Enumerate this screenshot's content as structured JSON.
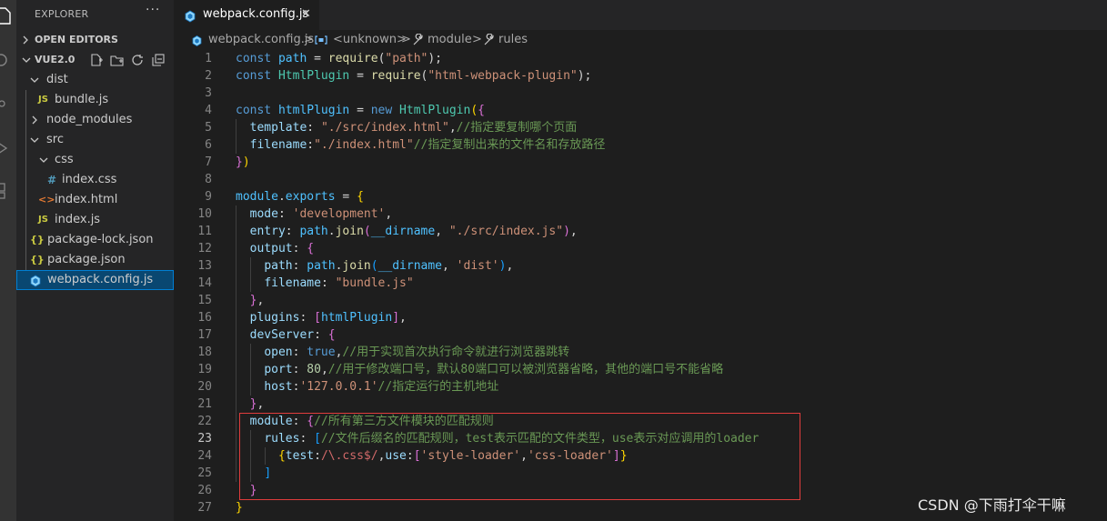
{
  "explorer": {
    "title": "EXPLORER",
    "more": "···",
    "open_editors": "OPEN EDITORS",
    "workspace": "VUE2.0",
    "tree": [
      {
        "label": "dist",
        "kind": "folder-open"
      },
      {
        "label": "bundle.js",
        "kind": "js",
        "icon_text": "JS"
      },
      {
        "label": "node_modules",
        "kind": "folder-closed"
      },
      {
        "label": "src",
        "kind": "folder-open"
      },
      {
        "label": "css",
        "kind": "folder-open"
      },
      {
        "label": "index.css",
        "kind": "css",
        "icon_text": "#"
      },
      {
        "label": "index.html",
        "kind": "html",
        "icon_text": "<>"
      },
      {
        "label": "index.js",
        "kind": "js",
        "icon_text": "JS"
      },
      {
        "label": "package-lock.json",
        "kind": "json",
        "icon_text": "{}"
      },
      {
        "label": "package.json",
        "kind": "json",
        "icon_text": "{}"
      },
      {
        "label": "webpack.config.js",
        "kind": "webpack",
        "selected": true
      }
    ]
  },
  "tab": {
    "label": "webpack.config.js",
    "close": "✕"
  },
  "breadcrumb": {
    "items": [
      "webpack.config.js",
      "<unknown>",
      "module",
      "rules"
    ],
    "separator": ">"
  },
  "editor": {
    "active_line": 23,
    "lines": [
      {
        "n": "1",
        "tokens": [
          [
            "kw",
            "const "
          ],
          [
            "var",
            "path"
          ],
          [
            "pn",
            " = "
          ],
          [
            "fn",
            "require"
          ],
          [
            "pn",
            "("
          ],
          [
            "str",
            "\"path\""
          ],
          [
            "pn",
            ");"
          ]
        ]
      },
      {
        "n": "2",
        "tokens": [
          [
            "kw",
            "const "
          ],
          [
            "cls",
            "HtmlPlugin"
          ],
          [
            "pn",
            " = "
          ],
          [
            "fn",
            "require"
          ],
          [
            "pn",
            "("
          ],
          [
            "str",
            "\"html-webpack-plugin\""
          ],
          [
            "pn",
            ");"
          ]
        ]
      },
      {
        "n": "3",
        "tokens": []
      },
      {
        "n": "4",
        "tokens": [
          [
            "kw",
            "const "
          ],
          [
            "var",
            "htmlPlugin"
          ],
          [
            "pn",
            " = "
          ],
          [
            "kw",
            "new "
          ],
          [
            "cls",
            "HtmlPlugin"
          ],
          [
            "br1",
            "("
          ],
          [
            "br2",
            "{"
          ]
        ]
      },
      {
        "n": "5",
        "tokens": [
          [
            "pn",
            "  "
          ],
          [
            "prop",
            "template"
          ],
          [
            "pn",
            ": "
          ],
          [
            "str",
            "\"./src/index.html\""
          ],
          [
            "pn",
            ","
          ],
          [
            "cm",
            "//指定要复制哪个页面"
          ]
        ]
      },
      {
        "n": "6",
        "tokens": [
          [
            "pn",
            "  "
          ],
          [
            "prop",
            "filename"
          ],
          [
            "pn",
            ":"
          ],
          [
            "str",
            "\"./index.html\""
          ],
          [
            "cm",
            "//指定复制出来的文件名和存放路径"
          ]
        ]
      },
      {
        "n": "7",
        "tokens": [
          [
            "br2",
            "}"
          ],
          [
            "br1",
            ")"
          ]
        ]
      },
      {
        "n": "8",
        "tokens": []
      },
      {
        "n": "9",
        "tokens": [
          [
            "var",
            "module"
          ],
          [
            "pn",
            "."
          ],
          [
            "var",
            "exports"
          ],
          [
            "pn",
            " = "
          ],
          [
            "br1",
            "{"
          ]
        ]
      },
      {
        "n": "10",
        "tokens": [
          [
            "pn",
            "  "
          ],
          [
            "prop",
            "mode"
          ],
          [
            "pn",
            ": "
          ],
          [
            "str",
            "'development'"
          ],
          [
            "pn",
            ","
          ]
        ]
      },
      {
        "n": "11",
        "tokens": [
          [
            "pn",
            "  "
          ],
          [
            "prop",
            "entry"
          ],
          [
            "pn",
            ": "
          ],
          [
            "var",
            "path"
          ],
          [
            "pn",
            "."
          ],
          [
            "fn",
            "join"
          ],
          [
            "br2",
            "("
          ],
          [
            "var",
            "__dirname"
          ],
          [
            "pn",
            ", "
          ],
          [
            "str",
            "\"./src/index.js\""
          ],
          [
            "br2",
            ")"
          ],
          [
            "pn",
            ","
          ]
        ]
      },
      {
        "n": "12",
        "tokens": [
          [
            "pn",
            "  "
          ],
          [
            "prop",
            "output"
          ],
          [
            "pn",
            ": "
          ],
          [
            "br2",
            "{"
          ]
        ]
      },
      {
        "n": "13",
        "tokens": [
          [
            "pn",
            "    "
          ],
          [
            "prop",
            "path"
          ],
          [
            "pn",
            ": "
          ],
          [
            "var",
            "path"
          ],
          [
            "pn",
            "."
          ],
          [
            "fn",
            "join"
          ],
          [
            "br3",
            "("
          ],
          [
            "var",
            "__dirname"
          ],
          [
            "pn",
            ", "
          ],
          [
            "str",
            "'dist'"
          ],
          [
            "br3",
            ")"
          ],
          [
            "pn",
            ","
          ]
        ]
      },
      {
        "n": "14",
        "tokens": [
          [
            "pn",
            "    "
          ],
          [
            "prop",
            "filename"
          ],
          [
            "pn",
            ": "
          ],
          [
            "str",
            "\"bundle.js\""
          ]
        ]
      },
      {
        "n": "15",
        "tokens": [
          [
            "pn",
            "  "
          ],
          [
            "br2",
            "}"
          ],
          [
            "pn",
            ","
          ]
        ]
      },
      {
        "n": "16",
        "tokens": [
          [
            "pn",
            "  "
          ],
          [
            "prop",
            "plugins"
          ],
          [
            "pn",
            ": "
          ],
          [
            "br2",
            "["
          ],
          [
            "var",
            "htmlPlugin"
          ],
          [
            "br2",
            "]"
          ],
          [
            "pn",
            ","
          ]
        ]
      },
      {
        "n": "17",
        "tokens": [
          [
            "pn",
            "  "
          ],
          [
            "prop",
            "devServer"
          ],
          [
            "pn",
            ": "
          ],
          [
            "br2",
            "{"
          ]
        ]
      },
      {
        "n": "18",
        "tokens": [
          [
            "pn",
            "    "
          ],
          [
            "prop",
            "open"
          ],
          [
            "pn",
            ": "
          ],
          [
            "kw",
            "true"
          ],
          [
            "pn",
            ","
          ],
          [
            "cm",
            "//用于实现首次执行命令就进行浏览器跳转"
          ]
        ]
      },
      {
        "n": "19",
        "tokens": [
          [
            "pn",
            "    "
          ],
          [
            "prop",
            "port"
          ],
          [
            "pn",
            ": "
          ],
          [
            "num",
            "80"
          ],
          [
            "pn",
            ","
          ],
          [
            "cm",
            "//用于修改端口号，默认80端口可以被浏览器省略，其他的端口号不能省略"
          ]
        ]
      },
      {
        "n": "20",
        "tokens": [
          [
            "pn",
            "    "
          ],
          [
            "prop",
            "host"
          ],
          [
            "pn",
            ":"
          ],
          [
            "str",
            "'127.0.0.1'"
          ],
          [
            "cm",
            "//指定运行的主机地址"
          ]
        ]
      },
      {
        "n": "21",
        "tokens": [
          [
            "pn",
            "  "
          ],
          [
            "br2",
            "}"
          ],
          [
            "pn",
            ","
          ]
        ]
      },
      {
        "n": "22",
        "tokens": [
          [
            "pn",
            "  "
          ],
          [
            "prop",
            "module"
          ],
          [
            "pn",
            ": "
          ],
          [
            "br2",
            "{"
          ],
          [
            "cm",
            "//所有第三方文件模块的匹配规则"
          ]
        ]
      },
      {
        "n": "23",
        "tokens": [
          [
            "pn",
            "    "
          ],
          [
            "prop",
            "rules"
          ],
          [
            "pn",
            ": "
          ],
          [
            "br3",
            "["
          ],
          [
            "cm",
            "//文件后缀名的匹配规则，test表示匹配的文件类型，use表示对应调用的loader"
          ]
        ]
      },
      {
        "n": "24",
        "tokens": [
          [
            "pn",
            "      "
          ],
          [
            "br1",
            "{"
          ],
          [
            "prop",
            "test"
          ],
          [
            "pn",
            ":"
          ],
          [
            "re",
            "/\\.css$/"
          ],
          [
            "pn",
            ","
          ],
          [
            "prop",
            "use"
          ],
          [
            "pn",
            ":"
          ],
          [
            "br2",
            "["
          ],
          [
            "str",
            "'style-loader'"
          ],
          [
            "pn",
            ","
          ],
          [
            "str",
            "'css-loader'"
          ],
          [
            "br2",
            "]"
          ],
          [
            "br1",
            "}"
          ]
        ]
      },
      {
        "n": "25",
        "tokens": [
          [
            "pn",
            "    "
          ],
          [
            "br3",
            "]"
          ]
        ]
      },
      {
        "n": "26",
        "tokens": [
          [
            "pn",
            "  "
          ],
          [
            "br2",
            "}"
          ]
        ]
      },
      {
        "n": "27",
        "tokens": [
          [
            "br1",
            "}"
          ]
        ]
      }
    ]
  },
  "watermark": "CSDN @下雨打伞干嘛"
}
